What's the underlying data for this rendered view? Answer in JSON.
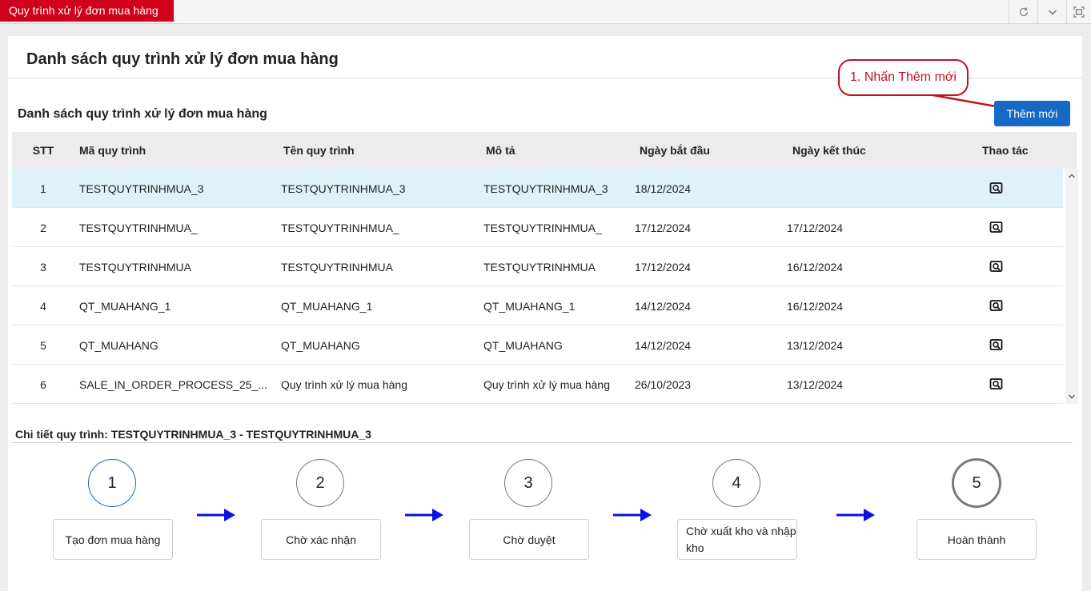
{
  "tab": {
    "title": "Quy trình xử lý đơn mua hàng"
  },
  "top_buttons": [
    {
      "icon": "refresh-icon"
    },
    {
      "icon": "chevron-down-icon"
    },
    {
      "icon": "fullscreen-icon"
    }
  ],
  "page": {
    "title": "Danh sách quy trình xử lý đơn mua hàng",
    "section_title": "Danh sách quy trình xử lý đơn mua hàng",
    "add_button": "Thêm mới",
    "annotation": "1. Nhấn Thêm mới"
  },
  "table": {
    "headers": {
      "stt": "STT",
      "ma": "Mã quy trình",
      "ten": "Tên quy trình",
      "mota": "Mô tả",
      "batdau": "Ngày bắt đầu",
      "ketthuc": "Ngày kết thúc",
      "thaotac": "Thao tác"
    },
    "rows": [
      {
        "stt": "1",
        "ma": "TESTQUYTRINHMUA_3",
        "ten": "TESTQUYTRINHMUA_3",
        "mota": "TESTQUYTRINHMUA_3",
        "batdau": "18/12/2024",
        "ketthuc": ""
      },
      {
        "stt": "2",
        "ma": "TESTQUYTRINHMUA_",
        "ten": "TESTQUYTRINHMUA_",
        "mota": "TESTQUYTRINHMUA_",
        "batdau": "17/12/2024",
        "ketthuc": "17/12/2024"
      },
      {
        "stt": "3",
        "ma": "TESTQUYTRINHMUA",
        "ten": "TESTQUYTRINHMUA",
        "mota": "TESTQUYTRINHMUA",
        "batdau": "17/12/2024",
        "ketthuc": "16/12/2024"
      },
      {
        "stt": "4",
        "ma": "QT_MUAHANG_1",
        "ten": "QT_MUAHANG_1",
        "mota": "QT_MUAHANG_1",
        "batdau": "14/12/2024",
        "ketthuc": "16/12/2024"
      },
      {
        "stt": "5",
        "ma": "QT_MUAHANG",
        "ten": "QT_MUAHANG",
        "mota": "QT_MUAHANG",
        "batdau": "14/12/2024",
        "ketthuc": "13/12/2024"
      },
      {
        "stt": "6",
        "ma": "SALE_IN_ORDER_PROCESS_25_...",
        "ten": "Quy trình xử lý mua hàng",
        "mota": "Quy trình xử lý mua hàng",
        "batdau": "26/10/2023",
        "ketthuc": "13/12/2024"
      }
    ],
    "row_action_icon": "view-detail-icon"
  },
  "detail": {
    "title": "Chi tiết quy trình: TESTQUYTRINHMUA_3 - TESTQUYTRINHMUA_3",
    "steps": [
      {
        "number": "1",
        "label": "Tạo đơn mua hàng"
      },
      {
        "number": "2",
        "label": "Chờ xác nhận"
      },
      {
        "number": "3",
        "label": "Chờ duyệt"
      },
      {
        "number": "4",
        "label": "Chờ xuất kho và nhập kho"
      },
      {
        "number": "5",
        "label": "Hoàn thành"
      }
    ]
  },
  "colors": {
    "tab_red": "#d0021b",
    "primary_blue": "#1769c7",
    "selected_row": "#dff2fa",
    "annotation_red": "#c1101e",
    "arrow_blue": "#0a14e0"
  }
}
